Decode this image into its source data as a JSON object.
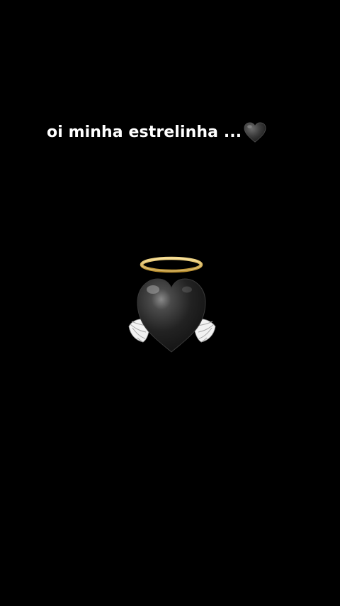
{
  "caption": {
    "text": "oi minha estrelinha ...",
    "trailing_icon": "black-heart-icon"
  },
  "center_graphic": {
    "icon": "angel-black-heart-halo-wings",
    "colors": {
      "background": "#000000",
      "heart": "#1c1c1c",
      "halo": "#e2bf63",
      "wings": "#eeeeee"
    }
  }
}
